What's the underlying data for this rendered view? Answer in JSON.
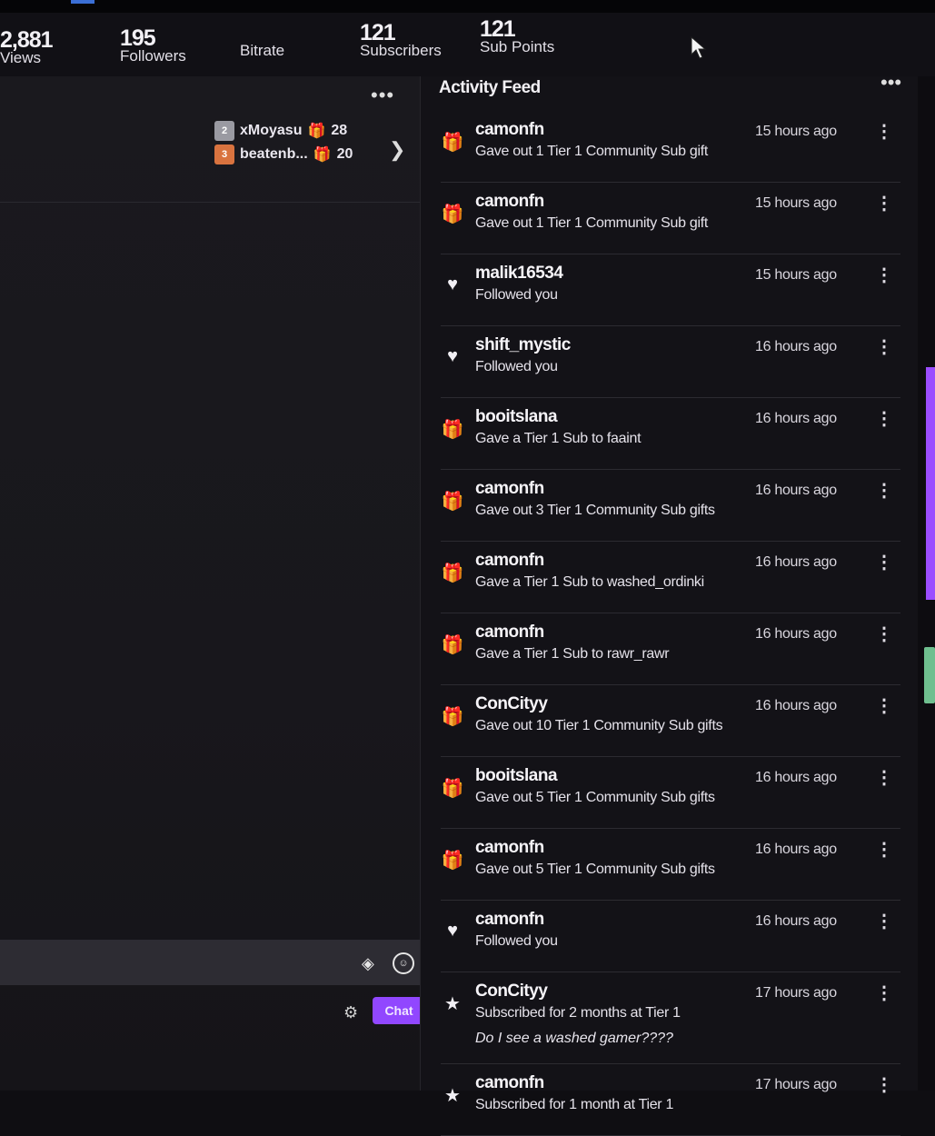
{
  "stats": {
    "views": {
      "value": "2,881",
      "label": "Views"
    },
    "followers": {
      "value": "195",
      "label": "Followers"
    },
    "bitrate": {
      "label": "Bitrate"
    },
    "subscribers": {
      "value": "121",
      "label": "Subscribers"
    },
    "sub_points": {
      "value": "121",
      "label": "Sub Points"
    }
  },
  "leaderboard": {
    "entries": [
      {
        "rank": "2",
        "name": "xMoyasu",
        "gifts": "28",
        "rank_color": "#9a9aa2",
        "gift_color": "#e3312d"
      },
      {
        "rank": "3",
        "name": "beatenb...",
        "gifts": "20",
        "rank_color": "#d9733f",
        "gift_color": "#3f8fe0"
      }
    ]
  },
  "activity_feed": {
    "title": "Activity Feed",
    "items": [
      {
        "icon": "gift-icon",
        "user": "camonfn",
        "desc": "Gave out 1 Tier 1 Community Sub gift",
        "time": "15 hours ago"
      },
      {
        "icon": "gift-icon",
        "user": "camonfn",
        "desc": "Gave out 1 Tier 1 Community Sub gift",
        "time": "15 hours ago"
      },
      {
        "icon": "heart-icon",
        "user": "malik16534",
        "desc": "Followed you",
        "time": "15 hours ago"
      },
      {
        "icon": "heart-icon",
        "user": "shift_mystic",
        "desc": "Followed you",
        "time": "16 hours ago"
      },
      {
        "icon": "gift-icon",
        "user": "booitslana",
        "desc": "Gave a Tier 1 Sub to faaint",
        "time": "16 hours ago"
      },
      {
        "icon": "gift-icon",
        "user": "camonfn",
        "desc": "Gave out 3 Tier 1 Community Sub gifts",
        "time": "16 hours ago"
      },
      {
        "icon": "gift-icon",
        "user": "camonfn",
        "desc": "Gave a Tier 1 Sub to washed_ordinki",
        "time": "16 hours ago"
      },
      {
        "icon": "gift-icon",
        "user": "camonfn",
        "desc": "Gave a Tier 1 Sub to rawr_rawr",
        "time": "16 hours ago"
      },
      {
        "icon": "gift-icon",
        "user": "ConCityy",
        "desc": "Gave out 10 Tier 1 Community Sub gifts",
        "time": "16 hours ago"
      },
      {
        "icon": "gift-icon",
        "user": "booitslana",
        "desc": "Gave out 5 Tier 1 Community Sub gifts",
        "time": "16 hours ago"
      },
      {
        "icon": "gift-icon",
        "user": "camonfn",
        "desc": "Gave out 5 Tier 1 Community Sub gifts",
        "time": "16 hours ago"
      },
      {
        "icon": "heart-icon",
        "user": "camonfn",
        "desc": "Followed you",
        "time": "16 hours ago"
      },
      {
        "icon": "star-icon",
        "user": "ConCityy",
        "desc": "Subscribed for 2 months at Tier 1",
        "time": "17 hours ago",
        "message": "Do I see a washed gamer????"
      },
      {
        "icon": "star-icon",
        "user": "camonfn",
        "desc": "Subscribed for 1 month at Tier 1",
        "time": "17 hours ago"
      }
    ]
  },
  "chat": {
    "button_label": "Chat"
  },
  "colors": {
    "accent": "#9147ff",
    "background": "#131217"
  }
}
